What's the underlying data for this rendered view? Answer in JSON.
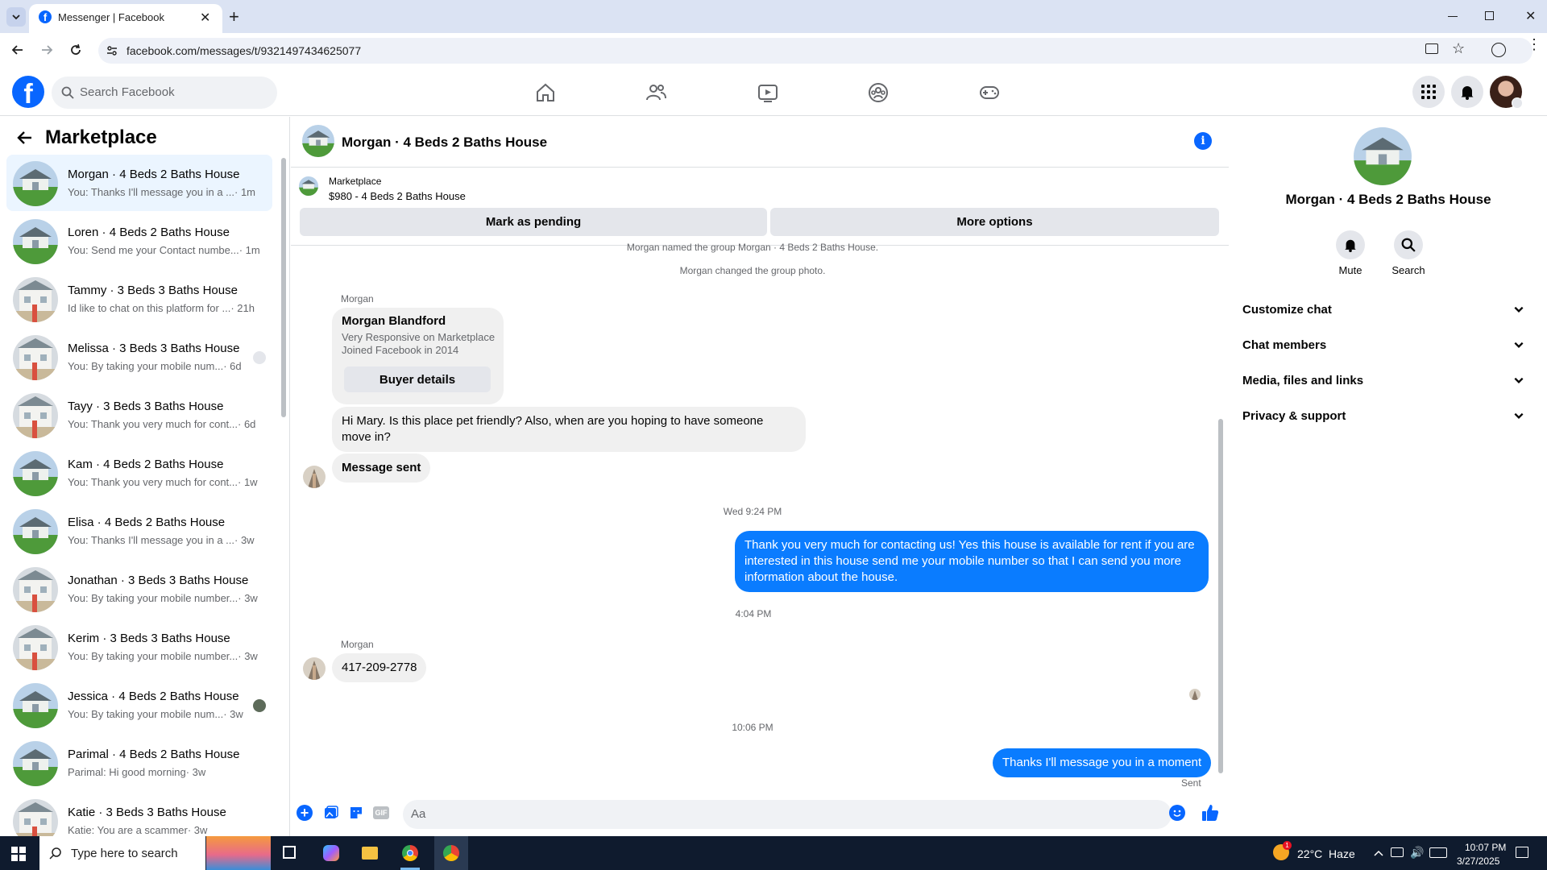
{
  "browser": {
    "tab_title": "Messenger | Facebook",
    "url": "facebook.com/messages/t/9321497434625077"
  },
  "header": {
    "search_placeholder": "Search Facebook"
  },
  "sidebar": {
    "title": "Marketplace",
    "conversations": [
      {
        "name": "Morgan · 4 Beds 2 Baths House",
        "preview": "You: Thanks I'll message you in a ...",
        "time": "· 1m",
        "active": true
      },
      {
        "name": "Loren · 4 Beds 2 Baths House",
        "preview": "You: Send me your Contact numbe...",
        "time": "· 1m"
      },
      {
        "name": "Tammy · 3 Beds 3 Baths House",
        "preview": "Id like to chat on this platform for ...",
        "time": "· 21h"
      },
      {
        "name": "Melissa · 3 Beds 3 Baths House",
        "preview": "You: By taking your mobile num...",
        "time": "· 6d"
      },
      {
        "name": "Tayy · 3 Beds 3 Baths House",
        "preview": "You: Thank you very much for cont...",
        "time": "· 6d"
      },
      {
        "name": "Kam · 4 Beds 2 Baths House",
        "preview": "You: Thank you very much for cont...",
        "time": "· 1w"
      },
      {
        "name": "Elisa · 4 Beds 2 Baths House",
        "preview": "You: Thanks I'll message you in a ...",
        "time": "· 3w"
      },
      {
        "name": "Jonathan · 3 Beds 3 Baths House",
        "preview": "You: By taking your mobile number...",
        "time": "· 3w"
      },
      {
        "name": "Kerim · 3 Beds 3 Baths House",
        "preview": "You: By taking your mobile number...",
        "time": "· 3w"
      },
      {
        "name": "Jessica · 4 Beds 2 Baths House",
        "preview": "You: By taking your mobile num...",
        "time": "· 3w"
      },
      {
        "name": "Parimal · 4 Beds 2 Baths House",
        "preview": "Parimal: Hi good morning",
        "time": "· 3w"
      },
      {
        "name": "Katie · 3 Beds 3 Baths House",
        "preview": "Katie: You are a scammer",
        "time": "· 3w"
      }
    ]
  },
  "chat": {
    "title": "Morgan · 4 Beds 2 Baths House",
    "listing_source": "Marketplace",
    "listing_title": "$980 - 4 Beds 2 Baths House",
    "mark_pending": "Mark as pending",
    "more_options": "More options",
    "sys_named": "Morgan named the group Morgan · 4 Beds 2 Baths House.",
    "sys_photo": "Morgan changed the group photo.",
    "sender1": "Morgan",
    "card_name": "Morgan Blandford",
    "card_line1": "Very Responsive on Marketplace",
    "card_line2": "Joined Facebook in 2014",
    "card_button": "Buyer details",
    "msg_in1": "Hi Mary. Is this place pet friendly? Also, when are you hoping to have someone move in?",
    "msg_in2": "Message sent",
    "ts1": "Wed 9:24 PM",
    "msg_out1": "Thank you very much for contacting us! Yes this house is available for rent if you are interested in this house send me your mobile number so that I can send you more information about the house.",
    "ts2": "4:04 PM",
    "sender2": "Morgan",
    "msg_in3": "417-209-2778",
    "ts3": "10:06 PM",
    "msg_out2": "Thanks I'll message you in a moment",
    "status": "Sent",
    "composer_placeholder": "Aa"
  },
  "details": {
    "name": "Morgan · 4 Beds 2 Baths House",
    "mute": "Mute",
    "search": "Search",
    "rows": [
      "Customize chat",
      "Chat members",
      "Media, files and links",
      "Privacy & support"
    ]
  },
  "taskbar": {
    "search_text": "Type here to search",
    "weather": "22°C  Haze",
    "time": "10:07 PM",
    "date": "3/27/2025",
    "weather_badge": "1"
  },
  "colors": {
    "brand": "#0866ff",
    "bubble_out": "#0a7cff",
    "bubble_in": "#f0f0f0"
  }
}
